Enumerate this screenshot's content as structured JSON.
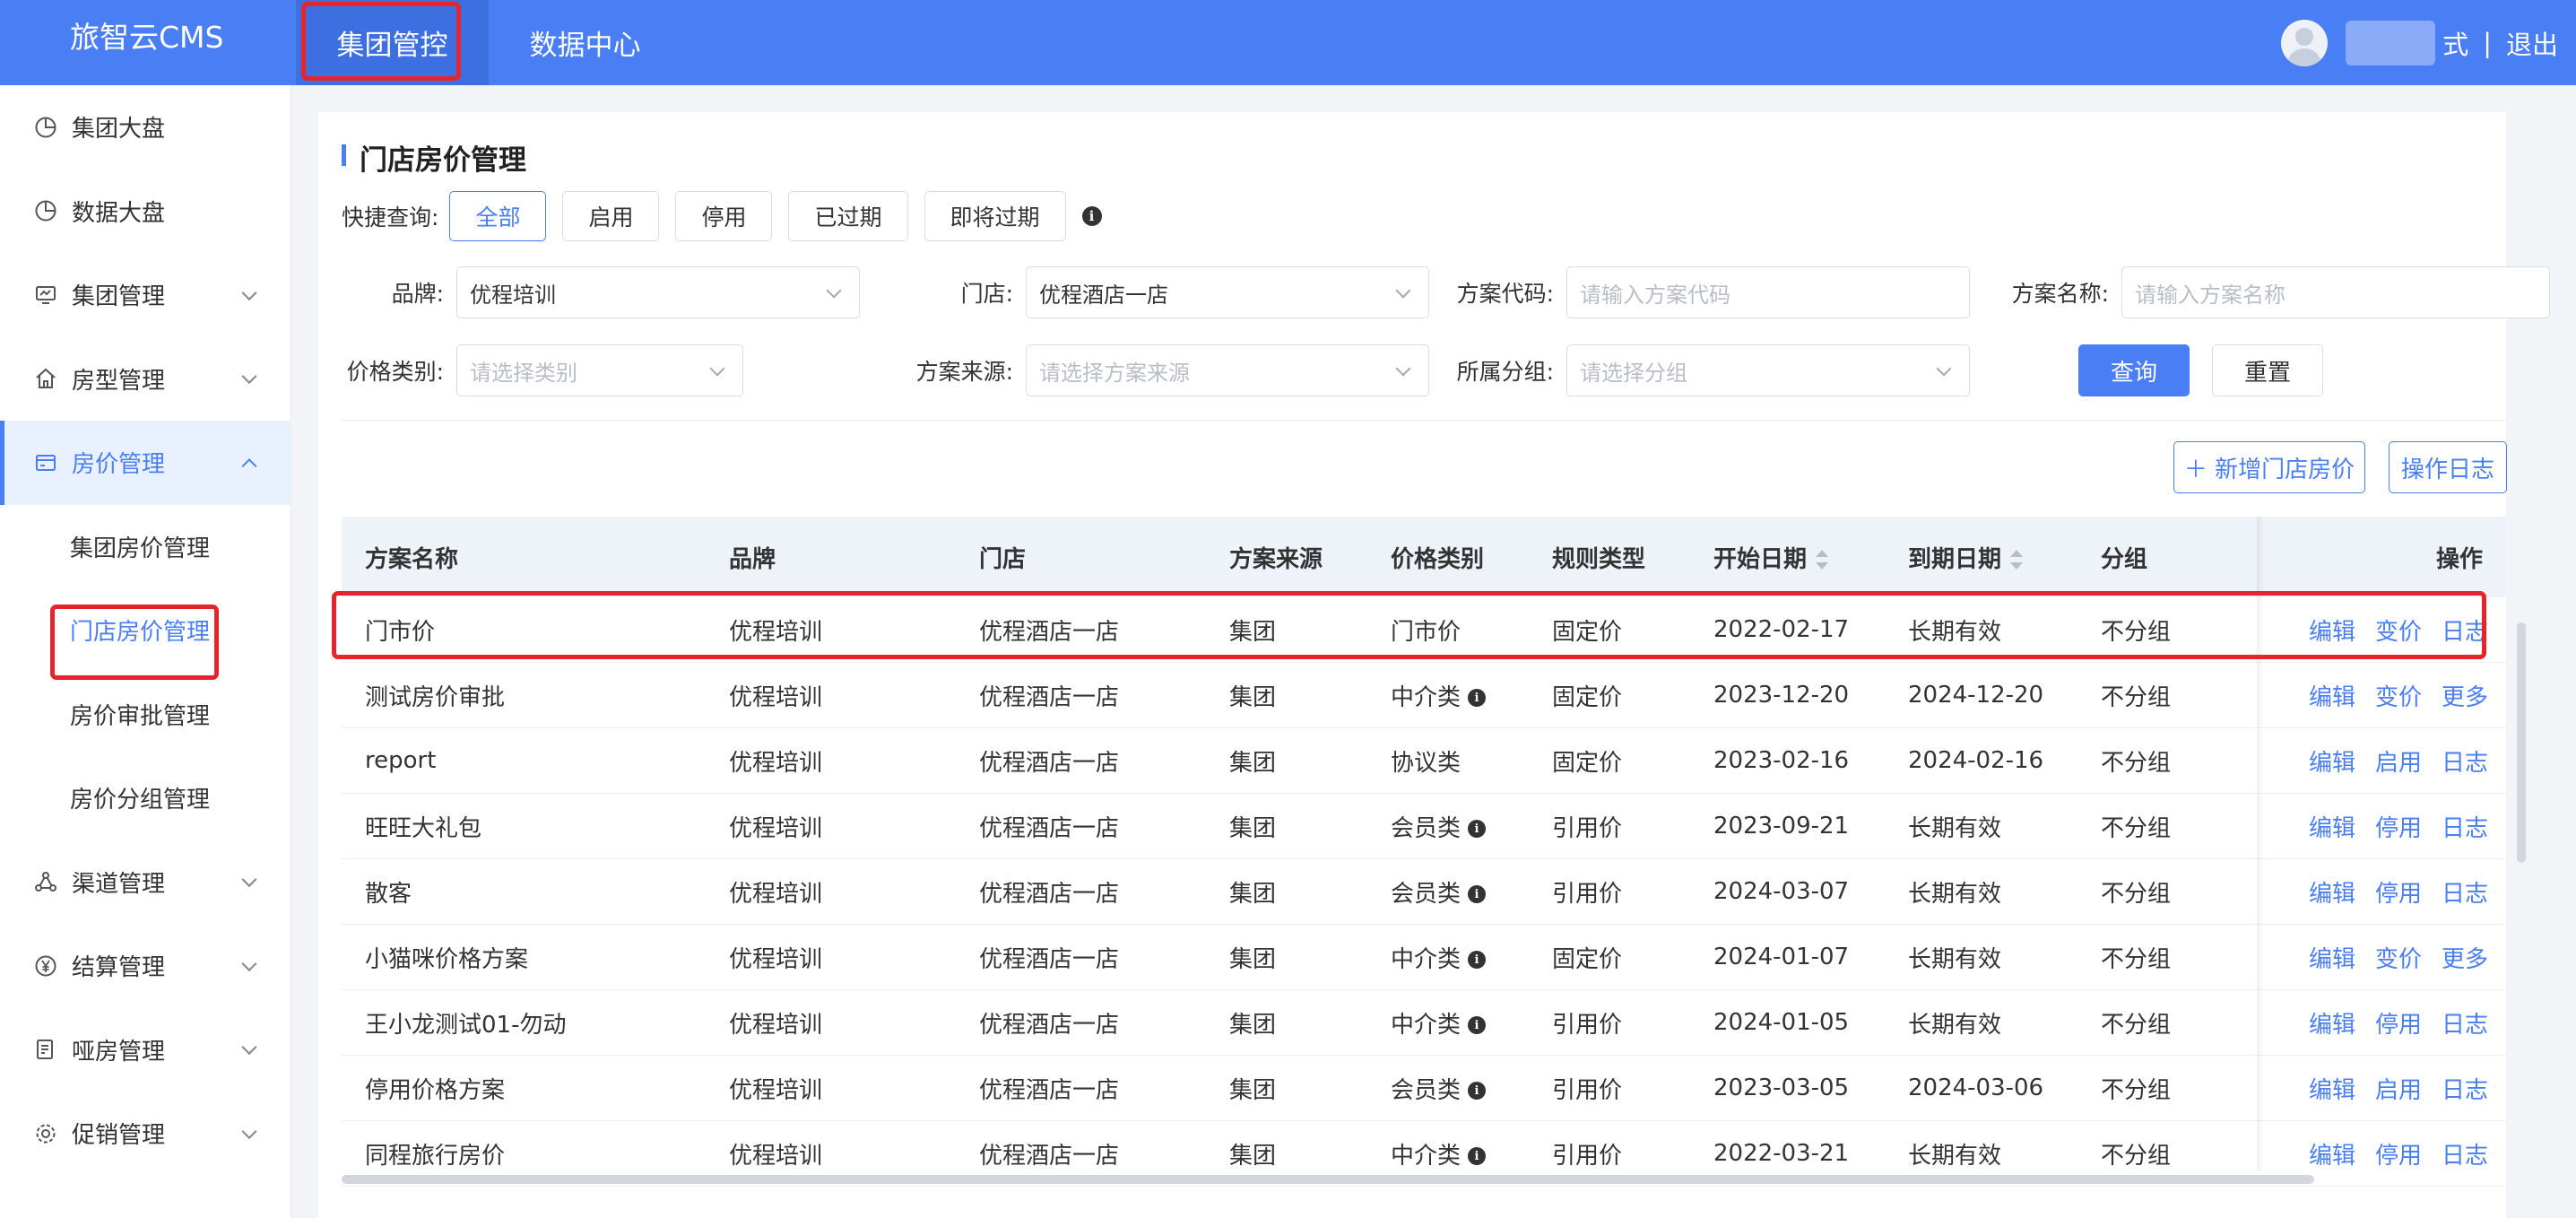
{
  "app": {
    "title": "旅智云CMS"
  },
  "topnav": [
    {
      "label": "集团管控",
      "active": true
    },
    {
      "label": "数据中心",
      "active": false
    }
  ],
  "user": {
    "suffix": "式",
    "separator": "|",
    "logout": "退出"
  },
  "sidebar": {
    "items": [
      {
        "label": "集团大盘",
        "icon": "pie-chart-icon"
      },
      {
        "label": "数据大盘",
        "icon": "pie-chart-icon"
      },
      {
        "label": "集团管理",
        "icon": "monitor-icon"
      },
      {
        "label": "房型管理",
        "icon": "home-icon"
      },
      {
        "label": "房价管理",
        "icon": "card-icon"
      },
      {
        "label": "渠道管理",
        "icon": "network-icon"
      },
      {
        "label": "结算管理",
        "icon": "yen-icon"
      },
      {
        "label": "哑房管理",
        "icon": "document-icon"
      },
      {
        "label": "促销管理",
        "icon": "gear-icon"
      }
    ],
    "sub_items": [
      {
        "label": "集团房价管理"
      },
      {
        "label": "门店房价管理"
      },
      {
        "label": "房价审批管理"
      },
      {
        "label": "房价分组管理"
      }
    ]
  },
  "page": {
    "title": "门店房价管理"
  },
  "quick": {
    "label": "快捷查询:",
    "buttons": [
      "全部",
      "启用",
      "停用",
      "已过期",
      "即将过期"
    ],
    "info": "i"
  },
  "filters": {
    "brand": {
      "label": "品牌:",
      "value": "优程培训"
    },
    "store": {
      "label": "门店:",
      "value": "优程酒店一店"
    },
    "code": {
      "label": "方案代码:",
      "placeholder": "请输入方案代码"
    },
    "name": {
      "label": "方案名称:",
      "placeholder": "请输入方案名称"
    },
    "price_type": {
      "label": "价格类别:",
      "placeholder": "请选择类别"
    },
    "source": {
      "label": "方案来源:",
      "placeholder": "请选择方案来源"
    },
    "group": {
      "label": "所属分组:",
      "placeholder": "请选择分组"
    },
    "search": "查询",
    "reset": "重置"
  },
  "actions": {
    "add": "＋ 新增门店房价",
    "log": "操作日志"
  },
  "table": {
    "headers": [
      "方案名称",
      "品牌",
      "门店",
      "方案来源",
      "价格类别",
      "规则类型",
      "开始日期",
      "到期日期",
      "分组",
      "操作"
    ],
    "rows": [
      {
        "name": "门市价",
        "brand": "优程培训",
        "store": "优程酒店一店",
        "source": "集团",
        "price_type": "门市价",
        "info": false,
        "rule": "固定价",
        "start": "2022-02-17",
        "end": "长期有效",
        "group": "不分组",
        "ops": [
          "编辑",
          "变价",
          "日志"
        ]
      },
      {
        "name": "测试房价审批",
        "brand": "优程培训",
        "store": "优程酒店一店",
        "source": "集团",
        "price_type": "中介类",
        "info": true,
        "rule": "固定价",
        "start": "2023-12-20",
        "end": "2024-12-20",
        "group": "不分组",
        "ops": [
          "编辑",
          "变价",
          "更多"
        ]
      },
      {
        "name": "report",
        "brand": "优程培训",
        "store": "优程酒店一店",
        "source": "集团",
        "price_type": "协议类",
        "info": false,
        "rule": "固定价",
        "start": "2023-02-16",
        "end": "2024-02-16",
        "group": "不分组",
        "ops": [
          "编辑",
          "启用",
          "日志"
        ]
      },
      {
        "name": "旺旺大礼包",
        "brand": "优程培训",
        "store": "优程酒店一店",
        "source": "集团",
        "price_type": "会员类",
        "info": true,
        "rule": "引用价",
        "start": "2023-09-21",
        "end": "长期有效",
        "group": "不分组",
        "ops": [
          "编辑",
          "停用",
          "日志"
        ]
      },
      {
        "name": "散客",
        "brand": "优程培训",
        "store": "优程酒店一店",
        "source": "集团",
        "price_type": "会员类",
        "info": true,
        "rule": "引用价",
        "start": "2024-03-07",
        "end": "长期有效",
        "group": "不分组",
        "ops": [
          "编辑",
          "停用",
          "日志"
        ]
      },
      {
        "name": "小猫咪价格方案",
        "brand": "优程培训",
        "store": "优程酒店一店",
        "source": "集团",
        "price_type": "中介类",
        "info": true,
        "rule": "固定价",
        "start": "2024-01-07",
        "end": "长期有效",
        "group": "不分组",
        "ops": [
          "编辑",
          "变价",
          "更多"
        ]
      },
      {
        "name": "王小龙测试01-勿动",
        "brand": "优程培训",
        "store": "优程酒店一店",
        "source": "集团",
        "price_type": "中介类",
        "info": true,
        "rule": "引用价",
        "start": "2024-01-05",
        "end": "长期有效",
        "group": "不分组",
        "ops": [
          "编辑",
          "停用",
          "日志"
        ]
      },
      {
        "name": "停用价格方案",
        "brand": "优程培训",
        "store": "优程酒店一店",
        "source": "集团",
        "price_type": "会员类",
        "info": true,
        "rule": "引用价",
        "start": "2023-03-05",
        "end": "2024-03-06",
        "group": "不分组",
        "ops": [
          "编辑",
          "启用",
          "日志"
        ]
      },
      {
        "name": "同程旅行房价",
        "brand": "优程培训",
        "store": "优程酒店一店",
        "source": "集团",
        "price_type": "中介类",
        "info": true,
        "rule": "引用价",
        "start": "2022-03-21",
        "end": "长期有效",
        "group": "不分组",
        "ops": [
          "编辑",
          "停用",
          "日志"
        ]
      }
    ]
  },
  "colors": {
    "primary": "#4a7ef5",
    "highlight": "#e5242b"
  }
}
